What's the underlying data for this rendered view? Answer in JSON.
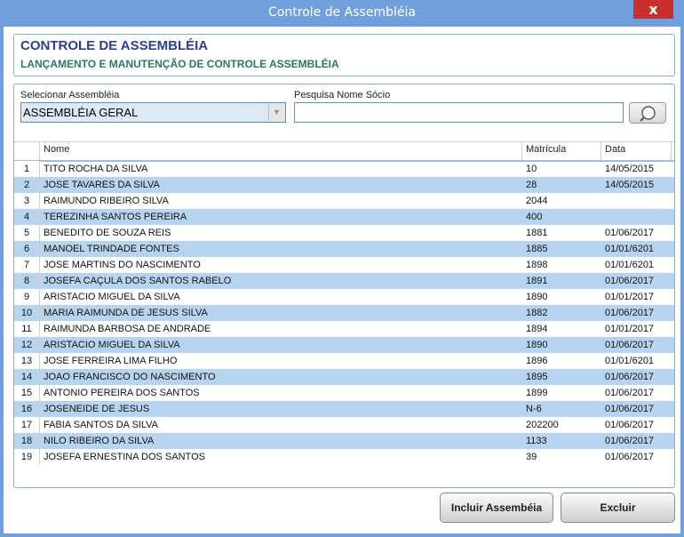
{
  "window": {
    "title": "Controle de Assembléia",
    "close_label": "x"
  },
  "header": {
    "title": "CONTROLE DE ASSEMBLÉIA",
    "subtitle": "LANÇAMENTO E MANUTENÇÃO DE CONTROLE ASSEMBLÉIA"
  },
  "filters": {
    "assembleia_label": "Selecionar Assembléia",
    "assembleia_value": "ASSEMBLÉIA GERAL",
    "search_label": "Pesquisa Nome Sócio",
    "search_value": ""
  },
  "grid": {
    "columns": [
      "Nome",
      "Matrícula",
      "Data"
    ],
    "rows": [
      {
        "n": "1",
        "nome": "TITO ROCHA DA SILVA",
        "matricula": "10",
        "data": "14/05/2015"
      },
      {
        "n": "2",
        "nome": "JOSE TAVARES DA SILVA",
        "matricula": "28",
        "data": "14/05/2015"
      },
      {
        "n": "3",
        "nome": "RAIMUNDO RIBEIRO SILVA",
        "matricula": "2044",
        "data": ""
      },
      {
        "n": "4",
        "nome": "TEREZINHA SANTOS PEREIRA",
        "matricula": "400",
        "data": ""
      },
      {
        "n": "5",
        "nome": "BENEDITO DE SOUZA REIS",
        "matricula": "1881",
        "data": "01/06/2017"
      },
      {
        "n": "6",
        "nome": "MANOEL TRINDADE FONTES",
        "matricula": "1885",
        "data": "01/01/6201"
      },
      {
        "n": "7",
        "nome": "JOSE MARTINS DO NASCIMENTO",
        "matricula": "1898",
        "data": "01/01/6201"
      },
      {
        "n": "8",
        "nome": "JOSEFA CAÇULA DOS SANTOS RABELO",
        "matricula": "1891",
        "data": "01/06/2017"
      },
      {
        "n": "9",
        "nome": "ARISTACIO MIGUEL DA SILVA",
        "matricula": "1890",
        "data": "01/01/2017"
      },
      {
        "n": "10",
        "nome": "MARIA RAIMUNDA DE JESUS SILVA",
        "matricula": "1882",
        "data": "01/06/2017"
      },
      {
        "n": "11",
        "nome": "RAIMUNDA BARBOSA DE ANDRADE",
        "matricula": "1894",
        "data": "01/01/2017"
      },
      {
        "n": "12",
        "nome": "ARISTACIO MIGUEL DA SILVA",
        "matricula": "1890",
        "data": "01/06/2017"
      },
      {
        "n": "13",
        "nome": "JOSE FERREIRA LIMA FILHO",
        "matricula": "1896",
        "data": "01/01/6201"
      },
      {
        "n": "14",
        "nome": "JOAO FRANCISCO DO NASCIMENTO",
        "matricula": "1895",
        "data": "01/06/2017"
      },
      {
        "n": "15",
        "nome": "ANTONIO PEREIRA DOS SANTOS",
        "matricula": "1899",
        "data": "01/06/2017"
      },
      {
        "n": "16",
        "nome": "JOSENEIDE DE JESUS",
        "matricula": "N-6",
        "data": "01/06/2017"
      },
      {
        "n": "17",
        "nome": "FABIA SANTOS DA SILVA",
        "matricula": "202200",
        "data": "01/06/2017"
      },
      {
        "n": "18",
        "nome": "NILO RIBEIRO DA SILVA",
        "matricula": "1133",
        "data": "01/06/2017"
      },
      {
        "n": "19",
        "nome": "JOSEFA ERNESTINA DOS SANTOS",
        "matricula": "39",
        "data": "01/06/2017"
      }
    ]
  },
  "buttons": {
    "incluir": "Incluir Assembéia",
    "excluir": "Excluir"
  },
  "colors": {
    "titlebar": "#6fa0dc",
    "close": "#c9302c",
    "row_alt": "#b7d4ef",
    "header_title": "#2a3f8f",
    "header_subtitle": "#2a7a5a"
  },
  "icons": {
    "close": "close-icon",
    "search": "search-icon",
    "dropdown": "chevron-down-icon"
  }
}
